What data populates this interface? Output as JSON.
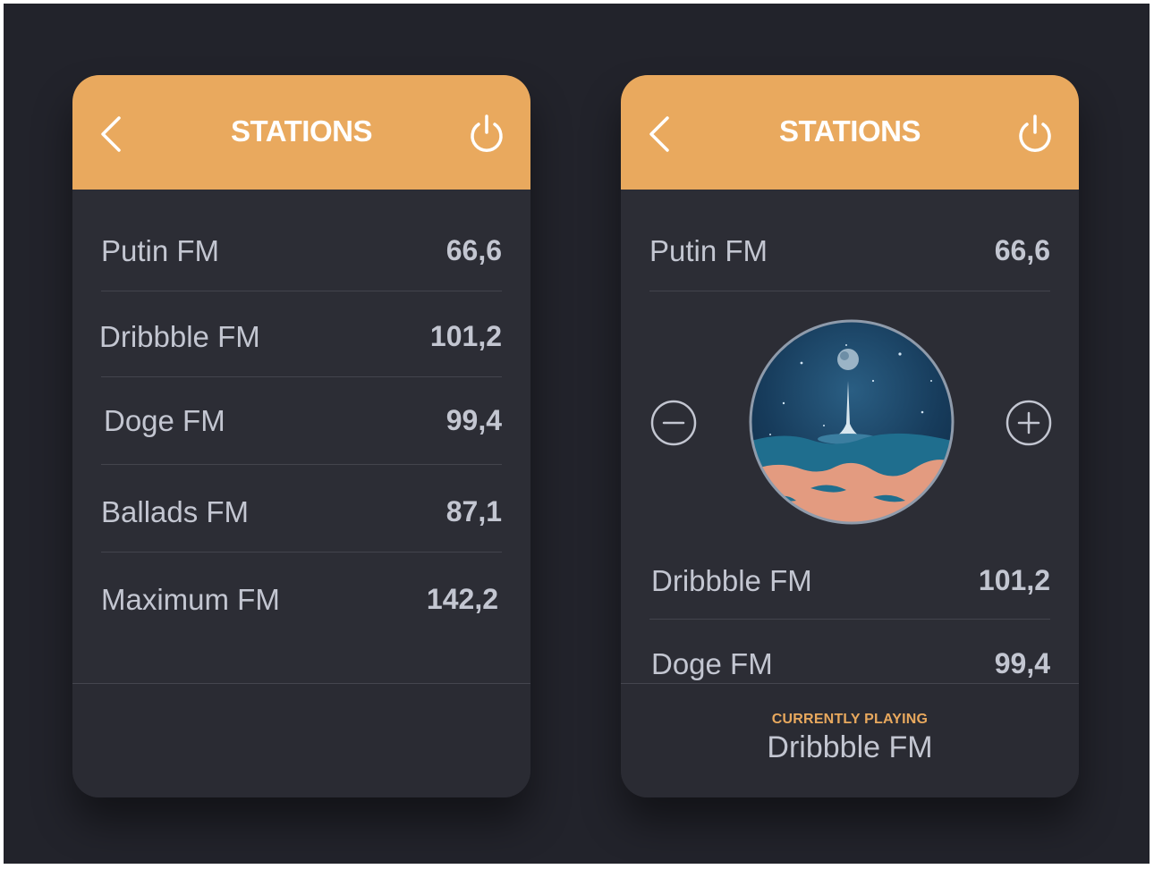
{
  "screens": [
    {
      "header": {
        "title": "STATIONS",
        "back_icon": "chevron-left-icon",
        "power_icon": "power-icon"
      },
      "stations": [
        {
          "name": "Putin FM",
          "freq": "66,6"
        },
        {
          "name": "Dribbble FM",
          "freq": "101,2"
        },
        {
          "name": "Doge FM",
          "freq": "99,4"
        },
        {
          "name": "Ballads FM",
          "freq": "87,1"
        },
        {
          "name": "Maximum FM",
          "freq": "142,2"
        }
      ]
    },
    {
      "header": {
        "title": "STATIONS",
        "back_icon": "chevron-left-icon",
        "power_icon": "power-icon"
      },
      "stations": [
        {
          "name": "Putin FM",
          "freq": "66,6"
        },
        {
          "name": "Dribbble FM",
          "freq": "101,2"
        },
        {
          "name": "Doge FM",
          "freq": "99,4"
        }
      ],
      "player": {
        "minus_icon": "minus-circle-icon",
        "plus_icon": "plus-circle-icon",
        "album_art": "album-cover-art"
      },
      "footer": {
        "label": "CURRENTLY PLAYING",
        "station": "Dribbble FM"
      }
    }
  ],
  "colors": {
    "accent": "#e9a95e",
    "card": "#2c2d35",
    "background": "#22232b",
    "text": "#c3c6d1"
  }
}
